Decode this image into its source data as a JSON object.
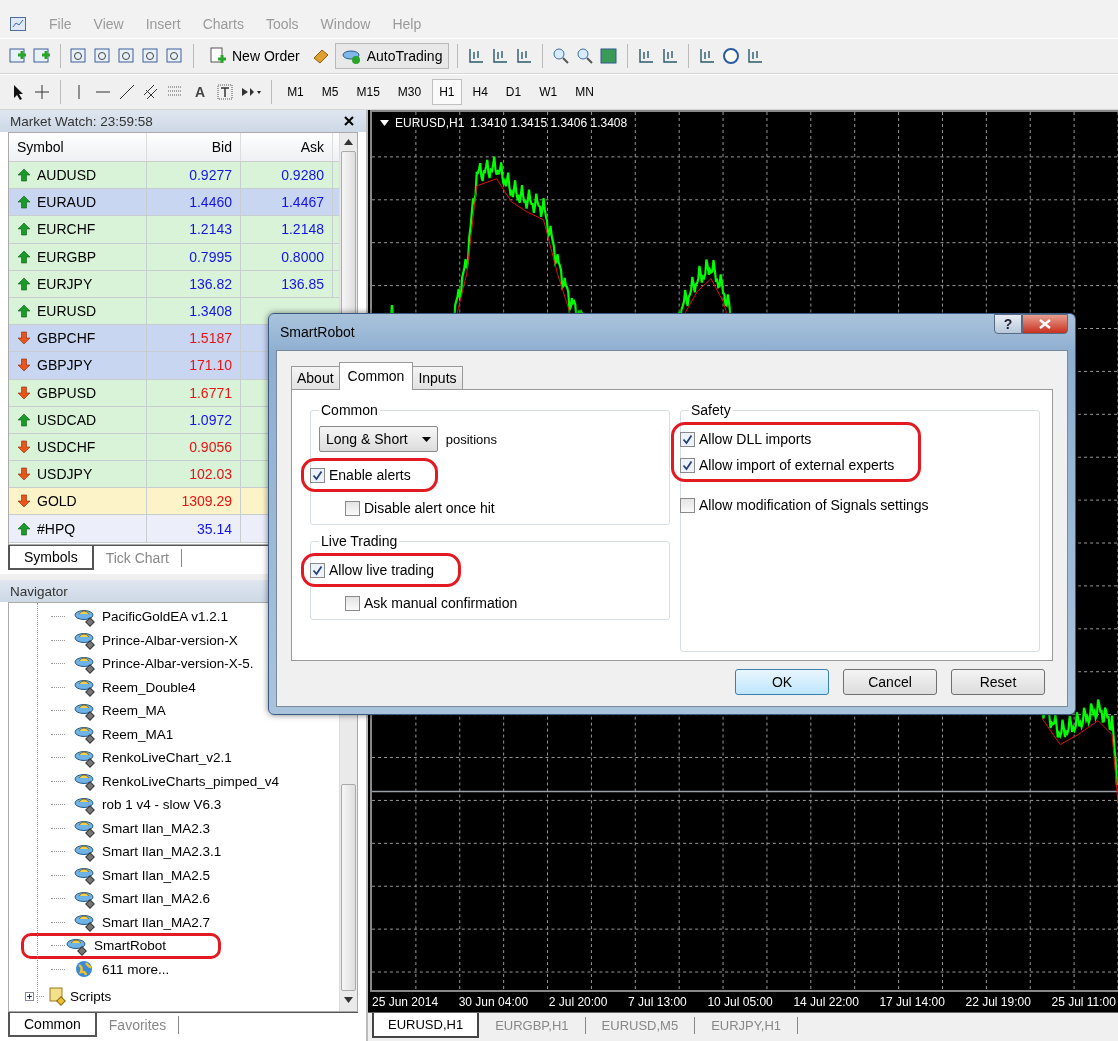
{
  "menu": [
    "File",
    "View",
    "Insert",
    "Charts",
    "Tools",
    "Window",
    "Help"
  ],
  "toolbar": {
    "new_order": "New Order",
    "autotrading": "AutoTrading"
  },
  "drawing_toolbar": {
    "text_tool": "A",
    "timeframes": [
      {
        "label": "M1",
        "selected": false
      },
      {
        "label": "M5",
        "selected": false
      },
      {
        "label": "M15",
        "selected": false
      },
      {
        "label": "M30",
        "selected": false
      },
      {
        "label": "H1",
        "selected": true
      },
      {
        "label": "H4",
        "selected": false
      },
      {
        "label": "D1",
        "selected": false
      },
      {
        "label": "W1",
        "selected": false
      },
      {
        "label": "MN",
        "selected": false
      }
    ]
  },
  "market_watch": {
    "title": "Market Watch: 23:59:58",
    "columns": [
      "Symbol",
      "Bid",
      "Ask"
    ],
    "rows": [
      {
        "symbol": "AUDUSD",
        "bid": "0.9277",
        "ask": "0.9280",
        "rising": true,
        "color": "#d9f3d9"
      },
      {
        "symbol": "EURAUD",
        "bid": "1.4460",
        "ask": "1.4467",
        "rising": true,
        "color": "#c8d6f2"
      },
      {
        "symbol": "EURCHF",
        "bid": "1.2143",
        "ask": "1.2148",
        "rising": true,
        "color": "#d9f3d9"
      },
      {
        "symbol": "EURGBP",
        "bid": "0.7995",
        "ask": "0.8000",
        "rising": true,
        "color": "#d9f3d9"
      },
      {
        "symbol": "EURJPY",
        "bid": "136.82",
        "ask": "136.85",
        "rising": true,
        "color": "#d9f3d9"
      },
      {
        "symbol": "EURUSD",
        "bid": "1.3408",
        "rising": true,
        "color": "#d9f3d9"
      },
      {
        "symbol": "GBPCHF",
        "bid": "1.5187",
        "rising": false,
        "color": "#c8d6f2"
      },
      {
        "symbol": "GBPJPY",
        "bid": "171.10",
        "rising": false,
        "color": "#c8d6f2"
      },
      {
        "symbol": "GBPUSD",
        "bid": "1.6771",
        "rising": false,
        "color": "#d9f3d9"
      },
      {
        "symbol": "USDCAD",
        "bid": "1.0972",
        "rising": true,
        "color": "#d9f3d9"
      },
      {
        "symbol": "USDCHF",
        "bid": "0.9056",
        "rising": false,
        "color": "#d9f3d9"
      },
      {
        "symbol": "USDJPY",
        "bid": "102.03",
        "rising": false,
        "color": "#d9f3d9"
      },
      {
        "symbol": "GOLD",
        "bid": "1309.29",
        "rising": false,
        "color": "#fdf3c8"
      },
      {
        "symbol": "#HPQ",
        "bid": "35.14",
        "rising": true,
        "color": "#eceef9"
      }
    ],
    "tabs": [
      {
        "label": "Symbols",
        "selected": true
      },
      {
        "label": "Tick Chart",
        "selected": false
      }
    ]
  },
  "navigator": {
    "title": "Navigator",
    "items": [
      {
        "label": "PacificGoldEA v1.2.1",
        "kind": "expert",
        "highlighted": false
      },
      {
        "label": "Prince-Albar-version-X",
        "kind": "expert",
        "highlighted": false
      },
      {
        "label": "Prince-Albar-version-X-5.",
        "kind": "expert",
        "highlighted": false
      },
      {
        "label": "Reem_Double4",
        "kind": "expert",
        "highlighted": false
      },
      {
        "label": "Reem_MA",
        "kind": "expert",
        "highlighted": false
      },
      {
        "label": "Reem_MA1",
        "kind": "expert",
        "highlighted": false
      },
      {
        "label": "RenkoLiveChart_v2.1",
        "kind": "expert",
        "highlighted": false
      },
      {
        "label": "RenkoLiveCharts_pimped_v4",
        "kind": "expert",
        "highlighted": false
      },
      {
        "label": "rob 1 v4 - slow V6.3",
        "kind": "expert",
        "highlighted": false
      },
      {
        "label": "Smart Ilan_MA2.3",
        "kind": "expert",
        "highlighted": false
      },
      {
        "label": "Smart Ilan_MA2.3.1",
        "kind": "expert",
        "highlighted": false
      },
      {
        "label": "Smart Ilan_MA2.5",
        "kind": "expert",
        "highlighted": false
      },
      {
        "label": "Smart Ilan_MA2.6",
        "kind": "expert",
        "highlighted": false
      },
      {
        "label": "Smart Ilan_MA2.7",
        "kind": "expert",
        "highlighted": false
      },
      {
        "label": "SmartRobot",
        "kind": "expert",
        "highlighted": true
      },
      {
        "label": "611 more...",
        "kind": "more",
        "highlighted": false
      }
    ],
    "scripts": {
      "label": "Scripts",
      "expanded": false
    },
    "tabs": [
      {
        "label": "Common",
        "selected": true
      },
      {
        "label": "Favorites",
        "selected": false
      }
    ]
  },
  "chart": {
    "symbol": "EURUSD,H1",
    "quotes": "1.3410 1.3415 1.3406 1.3408",
    "time_labels": [
      "25 Jun 2014",
      "30 Jun 04:00",
      "2 Jul 20:00",
      "7 Jul 13:00",
      "10 Jul 05:00",
      "14 Jul 22:00",
      "17 Jul 14:00",
      "22 Jul 19:00",
      "25 Jul 11:00"
    ],
    "tabs": [
      {
        "label": "EURUSD,H1",
        "selected": true
      },
      {
        "label": "EURGBP,H1",
        "selected": false
      },
      {
        "label": "EURUSD,M5",
        "selected": false
      },
      {
        "label": "EURJPY,H1",
        "selected": false
      }
    ]
  },
  "dialog": {
    "title": "SmartRobot",
    "help": "?",
    "tabs": [
      {
        "label": "About",
        "selected": false
      },
      {
        "label": "Common",
        "selected": true
      },
      {
        "label": "Inputs",
        "selected": false
      }
    ],
    "left_groups": [
      {
        "title": "Common",
        "select": {
          "value": "Long & Short",
          "suffix": "positions"
        },
        "options": [
          {
            "label": "Enable alerts",
            "checked": true,
            "highlighted": true,
            "children": [
              {
                "label": "Disable alert once hit",
                "checked": false
              }
            ]
          }
        ]
      },
      {
        "title": "Live Trading",
        "options": [
          {
            "label": "Allow live trading",
            "checked": true,
            "highlighted": true,
            "children": [
              {
                "label": "Ask manual confirmation",
                "checked": false
              }
            ]
          }
        ]
      }
    ],
    "right_groups": [
      {
        "title": "Safety",
        "options": [
          {
            "label": "Allow DLL imports",
            "checked": true,
            "highlighted": true
          },
          {
            "label": "Allow import of external experts",
            "checked": true,
            "highlighted": true
          },
          {
            "label": "Allow modification of Signals settings",
            "checked": false,
            "highlighted": false
          }
        ]
      }
    ],
    "buttons": [
      {
        "label": "OK",
        "default": true
      },
      {
        "label": "Cancel",
        "default": false
      },
      {
        "label": "Reset",
        "default": false
      }
    ]
  }
}
